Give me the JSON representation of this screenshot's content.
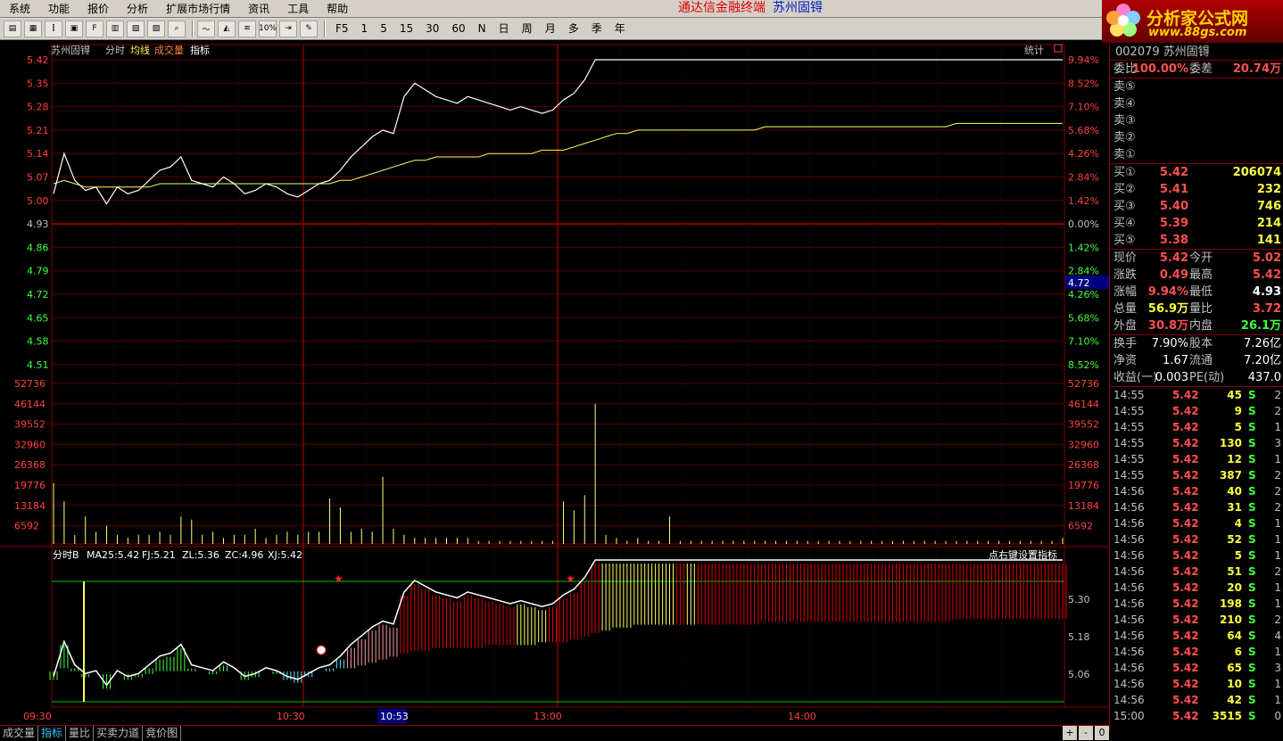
{
  "menu": {
    "items": [
      "系统",
      "功能",
      "报价",
      "分析",
      "扩展市场行情",
      "资讯",
      "工具",
      "帮助"
    ],
    "title": "通达信金融终端",
    "stock_name": "苏州固锝"
  },
  "toolbar": {
    "periods": [
      "F5",
      "1",
      "5",
      "15",
      "30",
      "60",
      "N",
      "日",
      "周",
      "月",
      "多",
      "季",
      "年"
    ],
    "zoom_label": "10%"
  },
  "logo": {
    "line1": "分析家公式网",
    "line2": "www.88gs.com"
  },
  "chart_header": {
    "stock": "苏州固锝",
    "labels": [
      "分时",
      "均线",
      "成交量",
      "指标"
    ],
    "stats_label": "统计"
  },
  "chart_data": {
    "type": "line",
    "time_labels": [
      "09:30",
      "10:30",
      "13:00",
      "14:00"
    ],
    "cursor_time": "10:53",
    "price_ticks": [
      "5.42",
      "5.35",
      "5.28",
      "5.21",
      "5.14",
      "5.07",
      "5.00",
      "4.93",
      "4.86",
      "4.79",
      "4.72",
      "4.65",
      "4.58",
      "4.51"
    ],
    "percent_ticks": [
      "9.94%",
      "8.52%",
      "7.10%",
      "5.68%",
      "4.26%",
      "2.84%",
      "1.42%",
      "0.00%",
      "1.42%",
      "2.84%",
      "4.26%",
      "5.68%",
      "7.10%",
      "8.52%"
    ],
    "cursor_price": "4.72",
    "prev_close": 4.93,
    "price_series": [
      5.02,
      5.14,
      5.06,
      5.03,
      5.04,
      4.99,
      5.04,
      5.02,
      5.03,
      5.06,
      5.09,
      5.1,
      5.13,
      5.06,
      5.05,
      5.04,
      5.07,
      5.05,
      5.02,
      5.03,
      5.05,
      5.04,
      5.02,
      5.01,
      5.03,
      5.05,
      5.06,
      5.09,
      5.13,
      5.16,
      5.19,
      5.21,
      5.2,
      5.31,
      5.35,
      5.33,
      5.31,
      5.3,
      5.29,
      5.31,
      5.3,
      5.29,
      5.28,
      5.27,
      5.28,
      5.27,
      5.26,
      5.27,
      5.3,
      5.32,
      5.36,
      5.42,
      5.42,
      5.42,
      5.42,
      5.42,
      5.42,
      5.42,
      5.42,
      5.42,
      5.42,
      5.42,
      5.42,
      5.42,
      5.42,
      5.42,
      5.42,
      5.42,
      5.42,
      5.42,
      5.42,
      5.42,
      5.42,
      5.42,
      5.42,
      5.42,
      5.42,
      5.42,
      5.42,
      5.42,
      5.42,
      5.42,
      5.42,
      5.42,
      5.42,
      5.42,
      5.42,
      5.42,
      5.42,
      5.42,
      5.42,
      5.42,
      5.42,
      5.42,
      5.42,
      5.42
    ],
    "avg_series": [
      5.05,
      5.06,
      5.05,
      5.04,
      5.04,
      5.04,
      5.04,
      5.04,
      5.04,
      5.04,
      5.05,
      5.05,
      5.05,
      5.05,
      5.05,
      5.05,
      5.05,
      5.05,
      5.05,
      5.05,
      5.05,
      5.05,
      5.05,
      5.05,
      5.05,
      5.05,
      5.05,
      5.06,
      5.06,
      5.07,
      5.08,
      5.09,
      5.1,
      5.11,
      5.12,
      5.12,
      5.13,
      5.13,
      5.13,
      5.13,
      5.13,
      5.14,
      5.14,
      5.14,
      5.14,
      5.14,
      5.15,
      5.15,
      5.15,
      5.16,
      5.17,
      5.18,
      5.19,
      5.2,
      5.2,
      5.21,
      5.21,
      5.21,
      5.21,
      5.21,
      5.21,
      5.21,
      5.21,
      5.21,
      5.21,
      5.21,
      5.21,
      5.22,
      5.22,
      5.22,
      5.22,
      5.22,
      5.22,
      5.22,
      5.22,
      5.22,
      5.22,
      5.22,
      5.22,
      5.22,
      5.22,
      5.22,
      5.22,
      5.22,
      5.22,
      5.23,
      5.23,
      5.23,
      5.23,
      5.23,
      5.23,
      5.23,
      5.23,
      5.23,
      5.23,
      5.23
    ],
    "volume_ticks": [
      "52736",
      "46144",
      "39552",
      "32960",
      "26368",
      "19776",
      "13184",
      "6592"
    ],
    "volume_max": 52736,
    "volume_series": [
      20000,
      14000,
      3000,
      9000,
      4000,
      6000,
      3000,
      2000,
      3000,
      3000,
      4000,
      3000,
      9000,
      8000,
      3000,
      4000,
      2000,
      3000,
      3000,
      5000,
      2000,
      3000,
      4000,
      3000,
      4000,
      4000,
      15000,
      12000,
      4000,
      5000,
      4000,
      22000,
      5000,
      3000,
      2000,
      2000,
      2000,
      2000,
      2000,
      2000,
      1000,
      1000,
      1000,
      1000,
      1000,
      1000,
      1000,
      1000,
      14000,
      11000,
      16000,
      46000,
      3000,
      2000,
      1000,
      2000,
      1000,
      1000,
      9000,
      1000,
      1000,
      1000,
      1000,
      1000,
      1000,
      1000,
      1000,
      1000,
      1000,
      1000,
      1000,
      1000,
      1000,
      1000,
      1000,
      1000,
      1000,
      1000,
      1000,
      1000,
      1000,
      1000,
      1000,
      1000,
      1000,
      1000,
      1000,
      1000,
      1000,
      1000,
      1000,
      1000,
      1000,
      1000,
      1000,
      2000
    ],
    "indicator": {
      "title": "分时B",
      "ma25": "MA25:5.42",
      "fj": "FJ:5.21",
      "zl": "ZL:5.36",
      "zc": "ZC:4.96",
      "xj": "XJ:5.42",
      "hint": "点右键设置指标",
      "ticks": [
        "5.30",
        "5.18",
        "5.06"
      ]
    }
  },
  "quote": {
    "code": "002079",
    "name": "苏州固锝",
    "weibi_label": "委比",
    "weibi": "100.00%",
    "weicha_label": "委差",
    "weicha": "20.74万",
    "sells": [
      {
        "label": "卖⑤"
      },
      {
        "label": "卖④"
      },
      {
        "label": "卖③"
      },
      {
        "label": "卖②"
      },
      {
        "label": "卖①"
      }
    ],
    "buys": [
      {
        "label": "买①",
        "price": "5.42",
        "vol": "206074"
      },
      {
        "label": "买②",
        "price": "5.41",
        "vol": "232"
      },
      {
        "label": "买③",
        "price": "5.40",
        "vol": "746"
      },
      {
        "label": "买④",
        "price": "5.39",
        "vol": "214"
      },
      {
        "label": "买⑤",
        "price": "5.38",
        "vol": "141"
      }
    ],
    "stats": [
      {
        "l1": "现价",
        "v1": "5.42",
        "c1": "red",
        "l2": "今开",
        "v2": "5.02",
        "c2": "red"
      },
      {
        "l1": "涨跌",
        "v1": "0.49",
        "c1": "red",
        "l2": "最高",
        "v2": "5.42",
        "c2": "red"
      },
      {
        "l1": "涨幅",
        "v1": "9.94%",
        "c1": "red",
        "l2": "最低",
        "v2": "4.93",
        "c2": "white"
      },
      {
        "l1": "总量",
        "v1": "56.9万",
        "c1": "yellow",
        "l2": "量比",
        "v2": "3.72",
        "c2": "red"
      },
      {
        "l1": "外盘",
        "v1": "30.8万",
        "c1": "red",
        "l2": "内盘",
        "v2": "26.1万",
        "c2": "green"
      }
    ],
    "fund": [
      {
        "l1": "换手",
        "v1": "7.90%",
        "l2": "股本",
        "v2": "7.26亿"
      },
      {
        "l1": "净资",
        "v1": "1.67",
        "l2": "流通",
        "v2": "7.20亿"
      },
      {
        "l1": "收益(一)",
        "v1": "0.003",
        "l2": "PE(动)",
        "v2": "437.0"
      }
    ]
  },
  "trades": [
    {
      "t": "14:55",
      "p": "5.42",
      "v": "45",
      "f": "S",
      "n": "2"
    },
    {
      "t": "14:55",
      "p": "5.42",
      "v": "9",
      "f": "S",
      "n": "2"
    },
    {
      "t": "14:55",
      "p": "5.42",
      "v": "5",
      "f": "S",
      "n": "1"
    },
    {
      "t": "14:55",
      "p": "5.42",
      "v": "130",
      "f": "S",
      "n": "3"
    },
    {
      "t": "14:55",
      "p": "5.42",
      "v": "12",
      "f": "S",
      "n": "1"
    },
    {
      "t": "14:55",
      "p": "5.42",
      "v": "387",
      "f": "S",
      "n": "2"
    },
    {
      "t": "14:56",
      "p": "5.42",
      "v": "40",
      "f": "S",
      "n": "2"
    },
    {
      "t": "14:56",
      "p": "5.42",
      "v": "31",
      "f": "S",
      "n": "2"
    },
    {
      "t": "14:56",
      "p": "5.42",
      "v": "4",
      "f": "S",
      "n": "1"
    },
    {
      "t": "14:56",
      "p": "5.42",
      "v": "52",
      "f": "S",
      "n": "1"
    },
    {
      "t": "14:56",
      "p": "5.42",
      "v": "5",
      "f": "S",
      "n": "1"
    },
    {
      "t": "14:56",
      "p": "5.42",
      "v": "51",
      "f": "S",
      "n": "2"
    },
    {
      "t": "14:56",
      "p": "5.42",
      "v": "20",
      "f": "S",
      "n": "1"
    },
    {
      "t": "14:56",
      "p": "5.42",
      "v": "198",
      "f": "S",
      "n": "1"
    },
    {
      "t": "14:56",
      "p": "5.42",
      "v": "210",
      "f": "S",
      "n": "2"
    },
    {
      "t": "14:56",
      "p": "5.42",
      "v": "64",
      "f": "S",
      "n": "4"
    },
    {
      "t": "14:56",
      "p": "5.42",
      "v": "6",
      "f": "S",
      "n": "1"
    },
    {
      "t": "14:56",
      "p": "5.42",
      "v": "65",
      "f": "S",
      "n": "3"
    },
    {
      "t": "14:56",
      "p": "5.42",
      "v": "10",
      "f": "S",
      "n": "1"
    },
    {
      "t": "14:56",
      "p": "5.42",
      "v": "42",
      "f": "S",
      "n": "1"
    },
    {
      "t": "15:00",
      "p": "5.42",
      "v": "3515",
      "f": "S",
      "n": "0"
    }
  ],
  "bottom_tabs": [
    "成交量",
    "指标",
    "量比",
    "买卖力道",
    "竞价图"
  ],
  "bottom_ctrls": [
    "+",
    "-",
    "0"
  ]
}
